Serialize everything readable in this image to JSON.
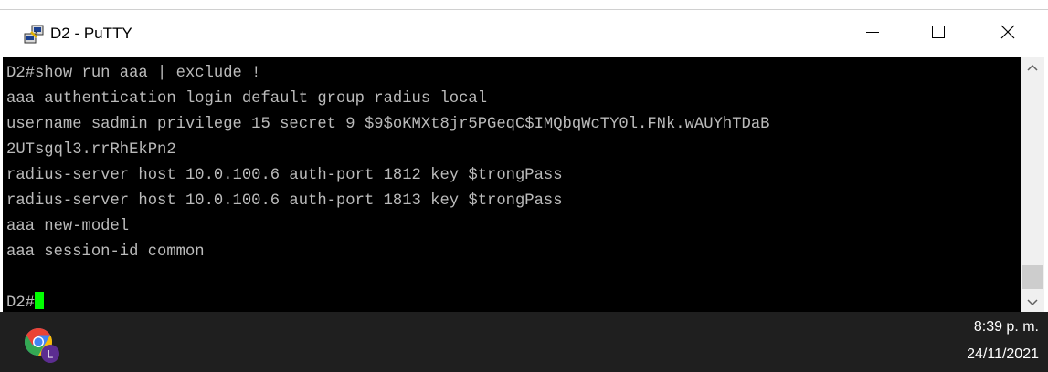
{
  "window": {
    "title": "D2 - PuTTY",
    "icon": "putty-icon",
    "controls": {
      "minimize": "minimize-icon",
      "maximize": "maximize-icon",
      "close": "close-icon"
    }
  },
  "terminal": {
    "lines": [
      "D2#show run aaa | exclude !",
      "aaa authentication login default group radius local",
      "username sadmin privilege 15 secret 9 $9$oKMXt8jr5PGeqC$IMQbqWcTY0l.FNk.wAUYhTDaB",
      "2UTsgql3.rrRhEkPn2",
      "radius-server host 10.0.100.6 auth-port 1812 key $trongPass",
      "radius-server host 10.0.100.6 auth-port 1813 key $trongPass",
      "aaa new-model",
      "aaa session-id common",
      "",
      "D2#"
    ],
    "text_color": "#bbbbbb",
    "background": "#000000",
    "cursor_color": "#00ff00"
  },
  "taskbar": {
    "app_icon": "chrome-profile-icon",
    "profile_badge": "L",
    "time": "8:39 p. m.",
    "date": "24/11/2021"
  }
}
